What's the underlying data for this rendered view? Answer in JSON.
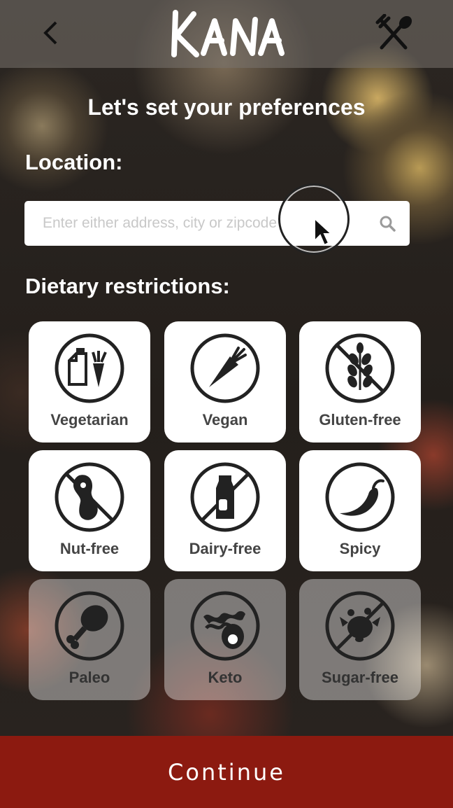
{
  "header": {
    "logo_text": "Kana",
    "back_icon": "chevron-left-icon",
    "menu_icon": "fork-spoon-icon"
  },
  "page": {
    "heading": "Let's set your preferences",
    "location_label": "Location:",
    "search_placeholder": "Enter either address, city or zipcode",
    "search_icon": "search-icon",
    "dietary_label": "Dietary restrictions:"
  },
  "diets": [
    {
      "label": "Vegetarian",
      "icon": "vegetarian-icon",
      "enabled": true
    },
    {
      "label": "Vegan",
      "icon": "vegan-icon",
      "enabled": true
    },
    {
      "label": "Gluten-free",
      "icon": "gluten-free-icon",
      "enabled": true
    },
    {
      "label": "Nut-free",
      "icon": "nut-free-icon",
      "enabled": true
    },
    {
      "label": "Dairy-free",
      "icon": "dairy-free-icon",
      "enabled": true
    },
    {
      "label": "Spicy",
      "icon": "chili-pepper-icon",
      "enabled": true
    },
    {
      "label": "Paleo",
      "icon": "drumstick-icon",
      "enabled": false
    },
    {
      "label": "Keto",
      "icon": "bacon-avocado-icon",
      "enabled": false
    },
    {
      "label": "Sugar-free",
      "icon": "sugar-free-icon",
      "enabled": false
    }
  ],
  "footer": {
    "continue_label": "Continue"
  },
  "colors": {
    "accent": "#8c1a10",
    "header_overlay": "#78736e",
    "icon": "#222222"
  }
}
